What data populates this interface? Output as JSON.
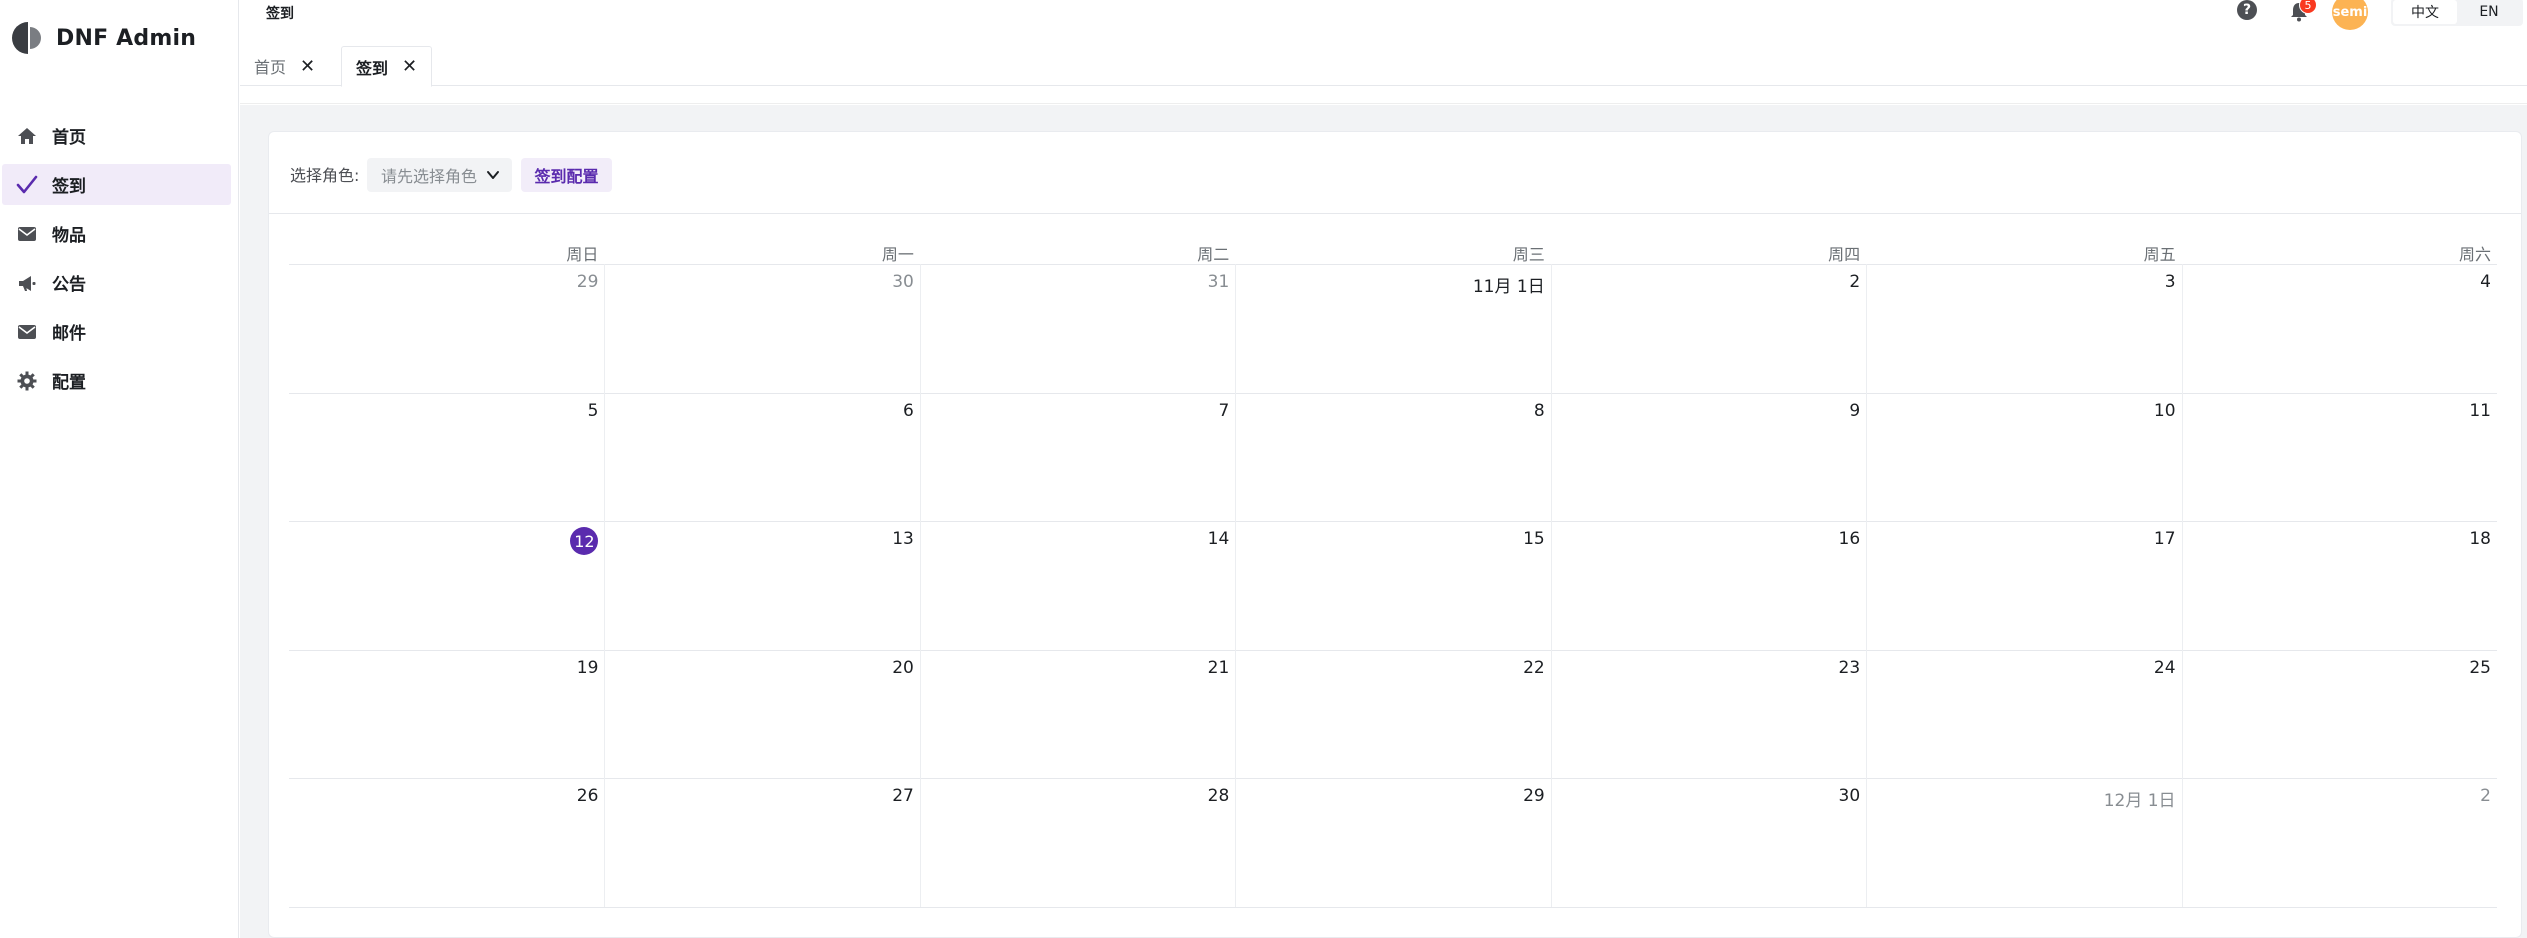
{
  "app": {
    "title": "DNF Admin"
  },
  "sidebar": {
    "items": [
      {
        "label": "首页",
        "icon": "home-icon"
      },
      {
        "label": "签到",
        "icon": "check-icon"
      },
      {
        "label": "物品",
        "icon": "mail-icon"
      },
      {
        "label": "公告",
        "icon": "megaphone-icon"
      },
      {
        "label": "邮件",
        "icon": "mail-icon"
      },
      {
        "label": "配置",
        "icon": "gear-icon"
      }
    ],
    "active_index": 1
  },
  "header": {
    "breadcrumb": "签到",
    "tabs": [
      {
        "label": "首页",
        "close": "✕"
      },
      {
        "label": "签到",
        "close": "✕"
      }
    ],
    "help_label": "?",
    "notification_count": "5",
    "avatar_text": "semi",
    "languages": [
      {
        "label": "中文"
      },
      {
        "label": "EN"
      }
    ],
    "active_language": "中文"
  },
  "toolbar": {
    "role_label": "选择角色:",
    "role_select_placeholder": "请先选择角色",
    "config_button": "签到配置"
  },
  "calendar": {
    "weekdays": [
      "周日",
      "周一",
      "周二",
      "周三",
      "周四",
      "周五",
      "周六"
    ],
    "weeks": [
      [
        {
          "t": "29",
          "m": true
        },
        {
          "t": "30",
          "m": true
        },
        {
          "t": "31",
          "m": true
        },
        {
          "t": "11月 1日"
        },
        {
          "t": "2"
        },
        {
          "t": "3"
        },
        {
          "t": "4"
        }
      ],
      [
        {
          "t": "5"
        },
        {
          "t": "6"
        },
        {
          "t": "7"
        },
        {
          "t": "8"
        },
        {
          "t": "9"
        },
        {
          "t": "10"
        },
        {
          "t": "11"
        }
      ],
      [
        {
          "t": "12",
          "today": true
        },
        {
          "t": "13"
        },
        {
          "t": "14"
        },
        {
          "t": "15"
        },
        {
          "t": "16"
        },
        {
          "t": "17"
        },
        {
          "t": "18"
        }
      ],
      [
        {
          "t": "19"
        },
        {
          "t": "20"
        },
        {
          "t": "21"
        },
        {
          "t": "22"
        },
        {
          "t": "23"
        },
        {
          "t": "24"
        },
        {
          "t": "25"
        }
      ],
      [
        {
          "t": "26"
        },
        {
          "t": "27"
        },
        {
          "t": "28"
        },
        {
          "t": "29"
        },
        {
          "t": "30"
        },
        {
          "t": "12月 1日",
          "m": true
        },
        {
          "t": "2",
          "m": true
        }
      ]
    ]
  },
  "colors": {
    "accent": "#5a2bae",
    "accent_bg": "#f1ebf9",
    "badge": "#f93920",
    "avatar": "#fcb353"
  }
}
